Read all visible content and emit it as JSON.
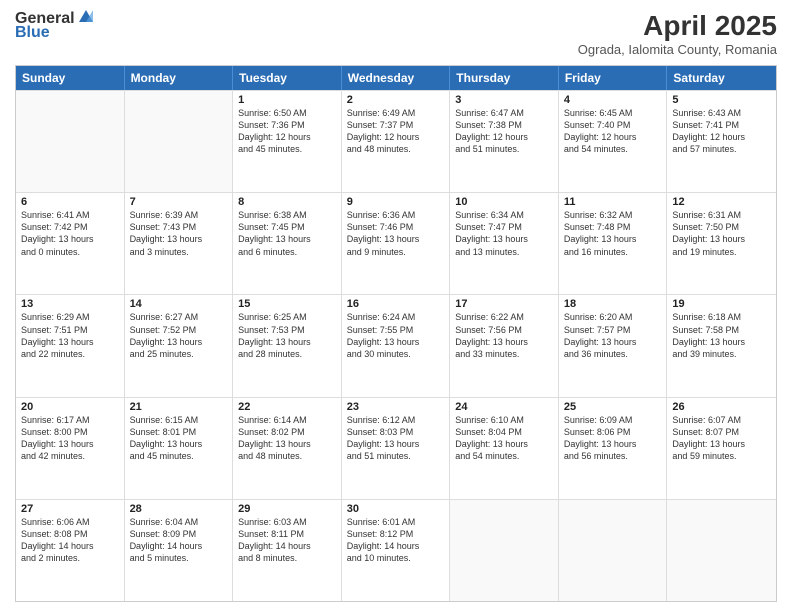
{
  "header": {
    "logo": {
      "general": "General",
      "blue": "Blue"
    },
    "title": "April 2025",
    "location": "Ograda, Ialomita County, Romania"
  },
  "days_of_week": [
    "Sunday",
    "Monday",
    "Tuesday",
    "Wednesday",
    "Thursday",
    "Friday",
    "Saturday"
  ],
  "weeks": [
    [
      {
        "day": "",
        "empty": true
      },
      {
        "day": "",
        "empty": true
      },
      {
        "day": "1",
        "line1": "Sunrise: 6:50 AM",
        "line2": "Sunset: 7:36 PM",
        "line3": "Daylight: 12 hours",
        "line4": "and 45 minutes."
      },
      {
        "day": "2",
        "line1": "Sunrise: 6:49 AM",
        "line2": "Sunset: 7:37 PM",
        "line3": "Daylight: 12 hours",
        "line4": "and 48 minutes."
      },
      {
        "day": "3",
        "line1": "Sunrise: 6:47 AM",
        "line2": "Sunset: 7:38 PM",
        "line3": "Daylight: 12 hours",
        "line4": "and 51 minutes."
      },
      {
        "day": "4",
        "line1": "Sunrise: 6:45 AM",
        "line2": "Sunset: 7:40 PM",
        "line3": "Daylight: 12 hours",
        "line4": "and 54 minutes."
      },
      {
        "day": "5",
        "line1": "Sunrise: 6:43 AM",
        "line2": "Sunset: 7:41 PM",
        "line3": "Daylight: 12 hours",
        "line4": "and 57 minutes."
      }
    ],
    [
      {
        "day": "6",
        "line1": "Sunrise: 6:41 AM",
        "line2": "Sunset: 7:42 PM",
        "line3": "Daylight: 13 hours",
        "line4": "and 0 minutes."
      },
      {
        "day": "7",
        "line1": "Sunrise: 6:39 AM",
        "line2": "Sunset: 7:43 PM",
        "line3": "Daylight: 13 hours",
        "line4": "and 3 minutes."
      },
      {
        "day": "8",
        "line1": "Sunrise: 6:38 AM",
        "line2": "Sunset: 7:45 PM",
        "line3": "Daylight: 13 hours",
        "line4": "and 6 minutes."
      },
      {
        "day": "9",
        "line1": "Sunrise: 6:36 AM",
        "line2": "Sunset: 7:46 PM",
        "line3": "Daylight: 13 hours",
        "line4": "and 9 minutes."
      },
      {
        "day": "10",
        "line1": "Sunrise: 6:34 AM",
        "line2": "Sunset: 7:47 PM",
        "line3": "Daylight: 13 hours",
        "line4": "and 13 minutes."
      },
      {
        "day": "11",
        "line1": "Sunrise: 6:32 AM",
        "line2": "Sunset: 7:48 PM",
        "line3": "Daylight: 13 hours",
        "line4": "and 16 minutes."
      },
      {
        "day": "12",
        "line1": "Sunrise: 6:31 AM",
        "line2": "Sunset: 7:50 PM",
        "line3": "Daylight: 13 hours",
        "line4": "and 19 minutes."
      }
    ],
    [
      {
        "day": "13",
        "line1": "Sunrise: 6:29 AM",
        "line2": "Sunset: 7:51 PM",
        "line3": "Daylight: 13 hours",
        "line4": "and 22 minutes."
      },
      {
        "day": "14",
        "line1": "Sunrise: 6:27 AM",
        "line2": "Sunset: 7:52 PM",
        "line3": "Daylight: 13 hours",
        "line4": "and 25 minutes."
      },
      {
        "day": "15",
        "line1": "Sunrise: 6:25 AM",
        "line2": "Sunset: 7:53 PM",
        "line3": "Daylight: 13 hours",
        "line4": "and 28 minutes."
      },
      {
        "day": "16",
        "line1": "Sunrise: 6:24 AM",
        "line2": "Sunset: 7:55 PM",
        "line3": "Daylight: 13 hours",
        "line4": "and 30 minutes."
      },
      {
        "day": "17",
        "line1": "Sunrise: 6:22 AM",
        "line2": "Sunset: 7:56 PM",
        "line3": "Daylight: 13 hours",
        "line4": "and 33 minutes."
      },
      {
        "day": "18",
        "line1": "Sunrise: 6:20 AM",
        "line2": "Sunset: 7:57 PM",
        "line3": "Daylight: 13 hours",
        "line4": "and 36 minutes."
      },
      {
        "day": "19",
        "line1": "Sunrise: 6:18 AM",
        "line2": "Sunset: 7:58 PM",
        "line3": "Daylight: 13 hours",
        "line4": "and 39 minutes."
      }
    ],
    [
      {
        "day": "20",
        "line1": "Sunrise: 6:17 AM",
        "line2": "Sunset: 8:00 PM",
        "line3": "Daylight: 13 hours",
        "line4": "and 42 minutes."
      },
      {
        "day": "21",
        "line1": "Sunrise: 6:15 AM",
        "line2": "Sunset: 8:01 PM",
        "line3": "Daylight: 13 hours",
        "line4": "and 45 minutes."
      },
      {
        "day": "22",
        "line1": "Sunrise: 6:14 AM",
        "line2": "Sunset: 8:02 PM",
        "line3": "Daylight: 13 hours",
        "line4": "and 48 minutes."
      },
      {
        "day": "23",
        "line1": "Sunrise: 6:12 AM",
        "line2": "Sunset: 8:03 PM",
        "line3": "Daylight: 13 hours",
        "line4": "and 51 minutes."
      },
      {
        "day": "24",
        "line1": "Sunrise: 6:10 AM",
        "line2": "Sunset: 8:04 PM",
        "line3": "Daylight: 13 hours",
        "line4": "and 54 minutes."
      },
      {
        "day": "25",
        "line1": "Sunrise: 6:09 AM",
        "line2": "Sunset: 8:06 PM",
        "line3": "Daylight: 13 hours",
        "line4": "and 56 minutes."
      },
      {
        "day": "26",
        "line1": "Sunrise: 6:07 AM",
        "line2": "Sunset: 8:07 PM",
        "line3": "Daylight: 13 hours",
        "line4": "and 59 minutes."
      }
    ],
    [
      {
        "day": "27",
        "line1": "Sunrise: 6:06 AM",
        "line2": "Sunset: 8:08 PM",
        "line3": "Daylight: 14 hours",
        "line4": "and 2 minutes."
      },
      {
        "day": "28",
        "line1": "Sunrise: 6:04 AM",
        "line2": "Sunset: 8:09 PM",
        "line3": "Daylight: 14 hours",
        "line4": "and 5 minutes."
      },
      {
        "day": "29",
        "line1": "Sunrise: 6:03 AM",
        "line2": "Sunset: 8:11 PM",
        "line3": "Daylight: 14 hours",
        "line4": "and 8 minutes."
      },
      {
        "day": "30",
        "line1": "Sunrise: 6:01 AM",
        "line2": "Sunset: 8:12 PM",
        "line3": "Daylight: 14 hours",
        "line4": "and 10 minutes."
      },
      {
        "day": "",
        "empty": true
      },
      {
        "day": "",
        "empty": true
      },
      {
        "day": "",
        "empty": true
      }
    ]
  ]
}
